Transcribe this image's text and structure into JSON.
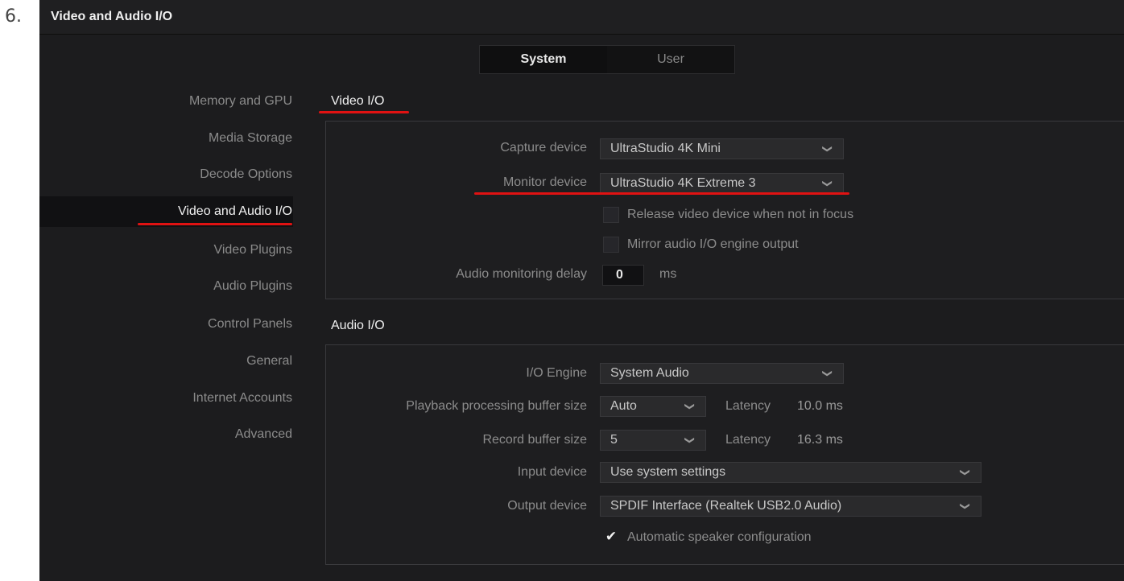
{
  "step_number": "6.",
  "window": {
    "title": "Video and Audio I/O"
  },
  "tabs": [
    {
      "label": "System",
      "active": true
    },
    {
      "label": "User",
      "active": false
    }
  ],
  "sidebar": {
    "items": [
      {
        "label": "Memory and GPU"
      },
      {
        "label": "Media Storage"
      },
      {
        "label": "Decode Options"
      },
      {
        "label": "Video and Audio I/O",
        "active": true
      },
      {
        "label": "Video Plugins"
      },
      {
        "label": "Audio Plugins"
      },
      {
        "label": "Control Panels"
      },
      {
        "label": "General"
      },
      {
        "label": "Internet Accounts"
      },
      {
        "label": "Advanced"
      }
    ]
  },
  "video_io": {
    "title": "Video I/O",
    "capture_device": {
      "label": "Capture device",
      "value": "UltraStudio 4K Mini"
    },
    "monitor_device": {
      "label": "Monitor device",
      "value": "UltraStudio 4K Extreme 3"
    },
    "release_video": {
      "label": "Release video device when not in focus",
      "checked": false
    },
    "mirror_audio": {
      "label": "Mirror audio I/O engine output",
      "checked": false
    },
    "audio_delay": {
      "label": "Audio monitoring delay",
      "value": "0",
      "unit": "ms"
    }
  },
  "audio_io": {
    "title": "Audio I/O",
    "io_engine": {
      "label": "I/O Engine",
      "value": "System Audio"
    },
    "playback_buffer": {
      "label": "Playback processing buffer size",
      "value": "Auto",
      "latency_label": "Latency",
      "latency_value": "10.0 ms"
    },
    "record_buffer": {
      "label": "Record buffer size",
      "value": "5",
      "latency_label": "Latency",
      "latency_value": "16.3 ms"
    },
    "input_device": {
      "label": "Input device",
      "value": "Use system settings"
    },
    "output_device": {
      "label": "Output device",
      "value": "SPDIF Interface (Realtek USB2.0 Audio)"
    },
    "auto_speaker": {
      "label": "Automatic speaker configuration",
      "checked": true,
      "check_glyph": "✔"
    }
  },
  "colors": {
    "highlight": "#e01212",
    "background": "#1c1c1e",
    "panel": "#1e1e20"
  },
  "icons": {
    "dropdown": "chevron-down-icon",
    "check": "checkmark-icon"
  }
}
